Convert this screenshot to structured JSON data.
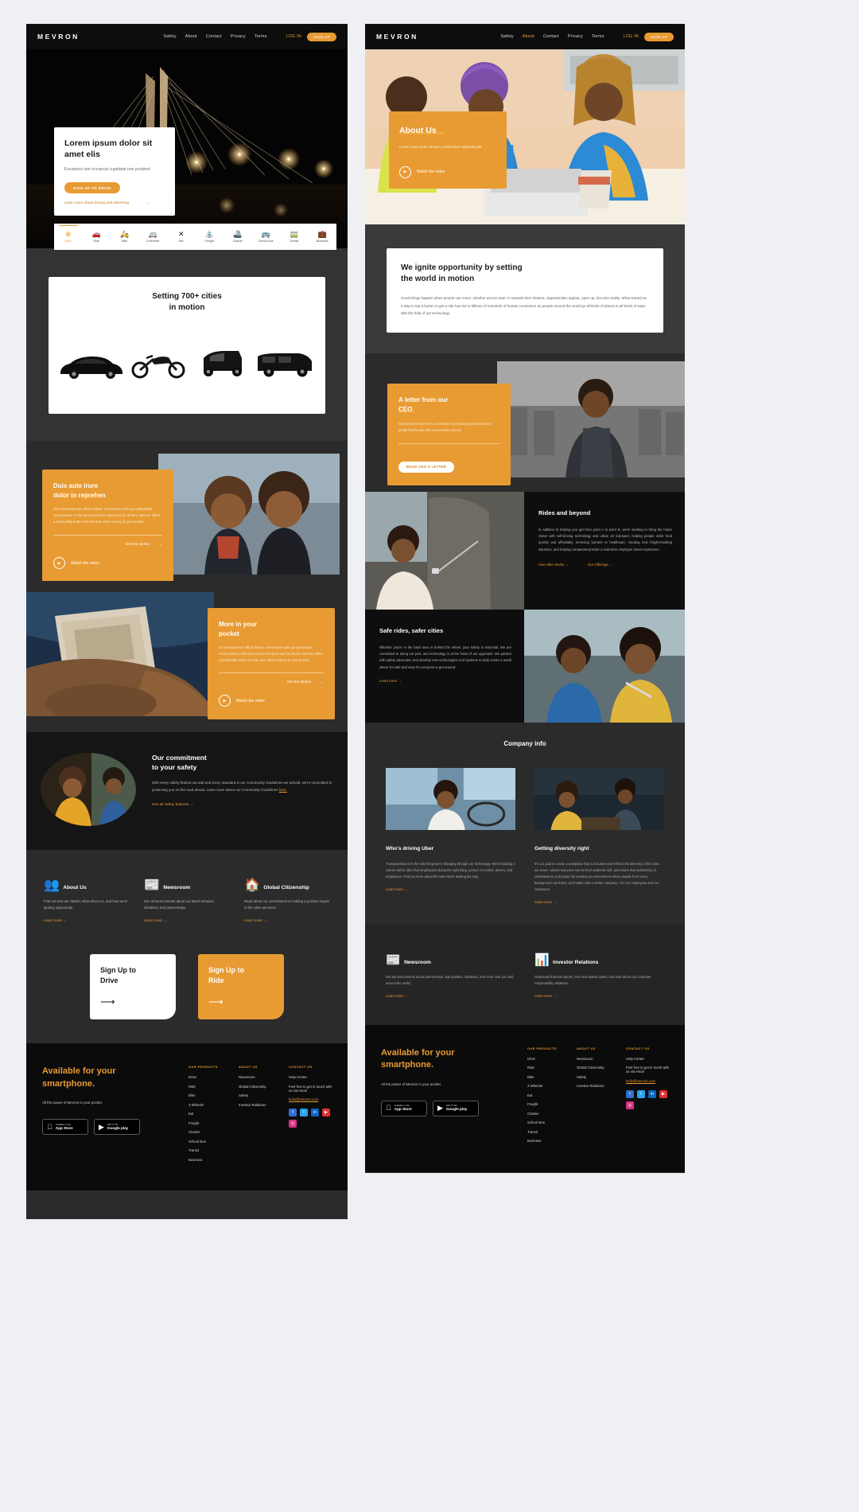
{
  "brand": "MEVRON",
  "nav": {
    "links": [
      "Safety",
      "About",
      "Contact",
      "Privacy",
      "Terms"
    ],
    "login": "LOG IN",
    "signup": "SIGN UP"
  },
  "colors": {
    "accent": "#e89b33",
    "dark": "#2b2b2b",
    "darker": "#0b0b0b"
  },
  "left": {
    "hero": {
      "title": "Lorem ipsum dolor sit amet elis",
      "subtitle": "Excepteur sint occaecat cupidatat non proident",
      "cta": "SIGN UP TO DRIVE",
      "link": "Learn more about driving and delivering",
      "link_arrow": "→"
    },
    "categories": [
      {
        "label": "Drive",
        "icon": "steering-wheel-icon",
        "glyph": "⊗",
        "active": true
      },
      {
        "label": "Ride",
        "icon": "car-icon",
        "glyph": "🚗",
        "active": false
      },
      {
        "label": "Bike",
        "icon": "motorbike-icon",
        "glyph": "🛵",
        "active": false
      },
      {
        "label": "3 Wheeler",
        "icon": "tuktuk-icon",
        "glyph": "🚐",
        "active": false
      },
      {
        "label": "Eat",
        "icon": "cutlery-icon",
        "glyph": "✕",
        "active": false
      },
      {
        "label": "Freight",
        "icon": "freight-icon",
        "glyph": "⛲",
        "active": false
      },
      {
        "label": "Charter",
        "icon": "boat-icon",
        "glyph": "🚢",
        "active": false
      },
      {
        "label": "School Bus",
        "icon": "bus-icon",
        "glyph": "🚌",
        "active": false
      },
      {
        "label": "Transit",
        "icon": "transit-icon",
        "glyph": "🚃",
        "active": false
      },
      {
        "label": "Business",
        "icon": "briefcase-icon",
        "glyph": "💼",
        "active": false
      }
    ],
    "cities": {
      "title_line1": "Setting 700+ cities",
      "title_line2": "in motion"
    },
    "duis": {
      "title_line1": "Duis aute irure",
      "title_line2": "dolor in reprehen",
      "body": "Duis consequuntur officia dolore, consectetur quis qui quibusdam consecutetur in the lacy access for client and for drivers, Mevron offers a profoundly better feel site quis dolor money in your pocket.",
      "see": "See the stories",
      "watch": "Watch the video",
      "arrow": "→"
    },
    "pocket": {
      "title_line1": "More in your",
      "title_line2": "pocket",
      "body": "Ex consequuntur officia dolore, consectetur quis qui quibusdam consecutetur in the lacy access for client and for drivers, Mevron offers a profoundly better feel site quis dolore money in your pocket.",
      "see": "See the stories",
      "watch": "Watch the video",
      "arrow": "→"
    },
    "commitment": {
      "title_line1": "Our commitment",
      "title_line2": "to your safety",
      "body": "With every safety feature we add and every standard in our Community Guidelines we uphold, we're committed to protecting you on the road ahead. Learn more about our Community Guidelines",
      "inline_link": "here.",
      "cta": "See all safety features",
      "arrow": "→"
    },
    "features": [
      {
        "icon": "people-icon",
        "glyph": "👥",
        "title": "About Us",
        "body": "Find out how we started, what drives us, and how we're igniting opportunity.",
        "link": "Learn more"
      },
      {
        "icon": "newspaper-icon",
        "glyph": "📰",
        "title": "Newsroom",
        "body": "See announcements about our latest releases, initiatives, and partnerships.",
        "link": "Learn more"
      },
      {
        "icon": "globe-home-icon",
        "glyph": "🏠",
        "title": "Global Citizenship",
        "body": "Read about our commitment to making a positive impact in the cities we serve.",
        "link": "Learn more"
      }
    ],
    "signup_cards": [
      {
        "title_line1": "Sign Up to",
        "title_line2": "Drive",
        "style": "white",
        "arrow": "⟶"
      },
      {
        "title_line1": "Sign Up to",
        "title_line2": "Ride",
        "style": "orange",
        "arrow": "⟶"
      }
    ]
  },
  "right": {
    "hero": {
      "title": "About Us",
      "body": "Lorem ipsum dolor sit amet, consectetur adipiscing elit",
      "watch": "Watch the video"
    },
    "ignite": {
      "title_line1": "We ignite opportunity by setting",
      "title_line2": "the world in motion",
      "body": "Good things happen when people can move, whether across town or towards their dreams. Opportunities appear, open up, become reality. What started as a way to tap a button to get a ride has led to billions of moments of human connection as people around the world go all kinds of places in all kinds of ways with the help of our technology."
    },
    "ceo": {
      "title_line1": "A letter from our",
      "title_line2": "CEO",
      "body": "Mevron drive has been committed to providing opportunity and global livelihoods with communities ahead.",
      "cta": "READ CEO'S LETTER"
    },
    "rides": {
      "title": "Rides and beyond",
      "body": "In addition to helping you get from point A to point B, we're working to bring the future closer with self-driving technology and urban air transport, helping people order food quickly and affordably, removing barriers to healthcare, creating new freight-booking solutions, and helping companies provide a seamless employee travel experience.",
      "link1": "How Uber Works",
      "link2": "Our Offerings",
      "arrow": "→"
    },
    "safe": {
      "title": "Safe rides, safer cities",
      "body": "Whether you're in the back seat or behind the wheel, your safety is essential. We are committed to doing our part, and technology is at the heart of our approach. We partner with safety advocates and develop new technologies and systems to help create a world where it's safe and easy for everyone to get around.",
      "link": "Learn more"
    },
    "company_info_title": "Company info",
    "company_cards": [
      {
        "title": "Who's driving Uber",
        "body": "Transportation isn't the only thing we're changing through our technology. We're building a culture within Uber that emphasizes doing the right thing, period. For riders, drivers, and employees. Find out more about the team that's leading the way.",
        "link": "Learn more"
      },
      {
        "title": "Getting diversity right",
        "body": "It's our goal to create a workplace that is inclusive and reflects the diversity of the cities we serve—where everyone can be their authentic self, and where that authenticity is celebrated as a strength. By creating an environment where people from every background can thrive, we'll make Uber a better company—for our employees and our customers.",
        "link": "Learn more"
      }
    ],
    "news_cards": [
      {
        "icon": "newspaper-icon",
        "glyph": "📰",
        "title": "Newsroom",
        "body": "Get announcements about partnerships, app updates, initiatives, and more near you and around the world.",
        "link": "Learn more"
      },
      {
        "icon": "investor-icon",
        "glyph": "📊",
        "title": "Investor Relations",
        "body": "Download financial reports, see next-quarter plans, and read about our corporate responsibility initiatives.",
        "link": "Learn more"
      }
    ]
  },
  "footer": {
    "heading_line1": "Available for your",
    "heading_line2": "smartphone.",
    "tagline": "All the power of Mevron in your pocket.",
    "stores": [
      {
        "name": "app-store",
        "small": "Available on the",
        "big": "App Store",
        "glyph": ""
      },
      {
        "name": "google-play",
        "small": "GET IT ON",
        "big": "Google play",
        "glyph": "▶"
      }
    ],
    "columns": [
      {
        "heading": "OUR PRODUCTS",
        "links": [
          "Drive",
          "Ride",
          "Bike",
          "3 Wheeler",
          "Eat",
          "Freight",
          "Charter",
          "School Bus",
          "Transit",
          "Business"
        ]
      },
      {
        "heading": "ABOUT US",
        "links": [
          "Newsroom",
          "Global Citizenship",
          "Safety",
          "Investor Relations"
        ]
      },
      {
        "heading": "CONTACT US",
        "links": [
          "Help Center",
          "Feel free to get in touch with us via email",
          "hello@mevron.com"
        ]
      }
    ],
    "social": [
      {
        "name": "facebook-icon",
        "glyph": "f",
        "cls": "fb"
      },
      {
        "name": "twitter-icon",
        "glyph": "t",
        "cls": "tw"
      },
      {
        "name": "linkedin-icon",
        "glyph": "in",
        "cls": "in"
      },
      {
        "name": "youtube-icon",
        "glyph": "▶",
        "cls": "yt"
      },
      {
        "name": "instagram-icon",
        "glyph": "◎",
        "cls": "ig"
      }
    ]
  }
}
